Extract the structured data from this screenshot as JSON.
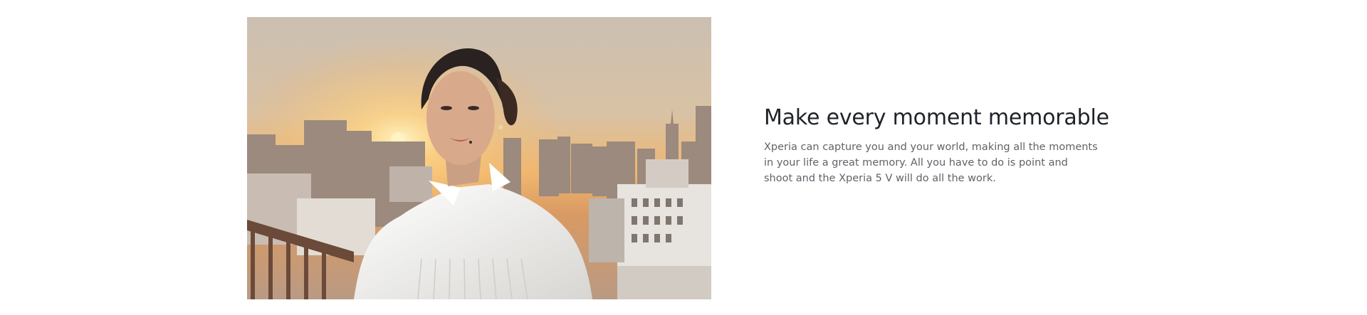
{
  "feature": {
    "headline": "Make every moment memorable",
    "body": "Xperia can capture you and your world, making all the moments in your life a great memory. All you have to do is point and shoot and the Xperia 5 V will do all the work."
  },
  "image": {
    "subject": "woman-in-white-shirt-on-rooftop-at-sunset",
    "palette": {
      "sky_top": "#cdbfae",
      "sky_glow": "#f2b56a",
      "sun": "#ffe7a3",
      "city": "#8e8479",
      "shirt": "#f1f0ec",
      "hair": "#2a2220",
      "skin": "#d9a98c",
      "railing": "#6b4a3a"
    }
  }
}
